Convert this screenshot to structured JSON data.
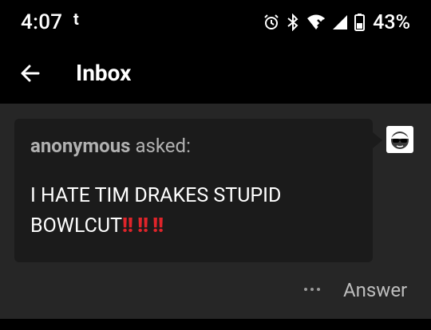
{
  "status_bar": {
    "time": "4:07",
    "notification_glyph": "t",
    "battery": "43%",
    "icons": [
      "alarm-icon",
      "bluetooth-icon",
      "wifi-icon",
      "cell-signal-icon",
      "battery-icon"
    ]
  },
  "app_bar": {
    "title": "Inbox",
    "back_icon": "arrow-left-icon"
  },
  "ask": {
    "asker": "anonymous",
    "verb": "asked:",
    "question_line1": "I HATE TIM DRAKES STUPID",
    "question_line2": "BOWLCUT",
    "emphasis": [
      "‼",
      "‼",
      "‼"
    ]
  },
  "actions": {
    "more_icon": "more-dots-icon",
    "answer_label": "Answer"
  },
  "colors": {
    "background": "#000000",
    "panel": "#262626",
    "bubble": "#1b1b1b",
    "emphasis": "#e0242a"
  }
}
